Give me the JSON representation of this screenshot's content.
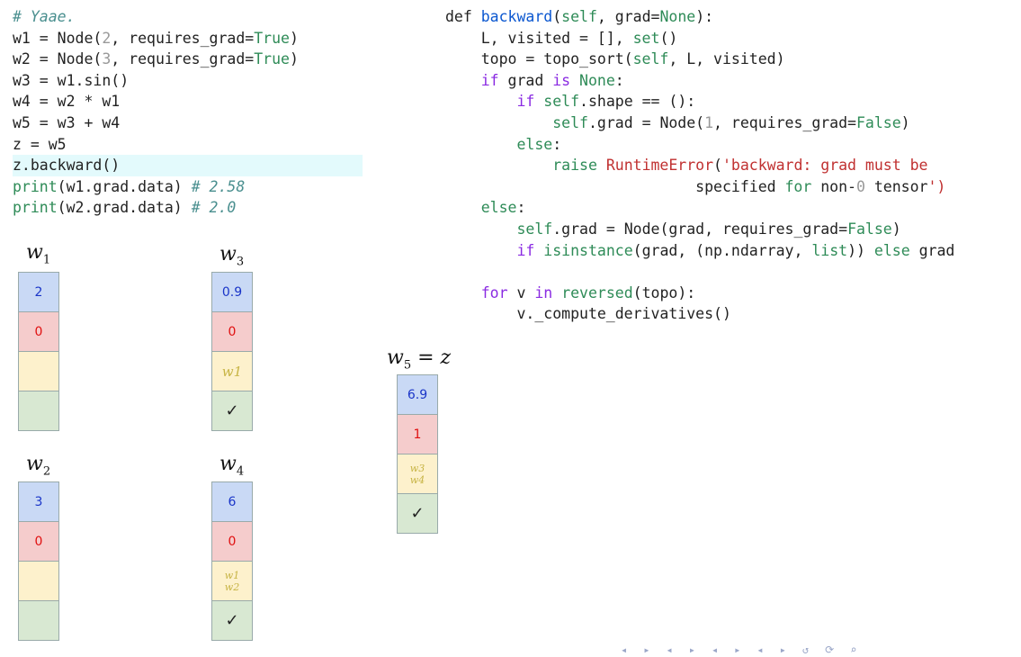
{
  "left_code": [
    {
      "parts": [
        [
          "cm",
          "# Yaae."
        ]
      ]
    },
    {
      "parts": [
        [
          "t",
          "w1 = Node("
        ],
        [
          "num",
          "2"
        ],
        [
          "t",
          ", requires_grad="
        ],
        [
          "tr",
          "True"
        ],
        [
          "t",
          ")"
        ]
      ]
    },
    {
      "parts": [
        [
          "t",
          "w2 = Node("
        ],
        [
          "num",
          "3"
        ],
        [
          "t",
          ", requires_grad="
        ],
        [
          "tr",
          "True"
        ],
        [
          "t",
          ")"
        ]
      ]
    },
    {
      "parts": [
        [
          "t",
          "w3 = w1.sin()"
        ]
      ]
    },
    {
      "parts": [
        [
          "t",
          "w4 = w2 * w1"
        ]
      ]
    },
    {
      "parts": [
        [
          "t",
          "w5 = w3 + w4"
        ]
      ]
    },
    {
      "parts": [
        [
          "t",
          "z = w5"
        ]
      ]
    },
    {
      "parts": [
        [
          "t",
          "z.backward()"
        ]
      ],
      "highlight": true
    },
    {
      "parts": [
        [
          "blt",
          "print"
        ],
        [
          "t",
          "(w1.grad.data) "
        ],
        [
          "cm",
          "# 2.58"
        ]
      ]
    },
    {
      "parts": [
        [
          "blt",
          "print"
        ],
        [
          "t",
          "(w2.grad.data) "
        ],
        [
          "cm",
          "# 2.0"
        ]
      ]
    }
  ],
  "right_code": [
    {
      "parts": [
        [
          "t",
          "def "
        ],
        [
          "fn",
          "backward"
        ],
        [
          "t",
          "("
        ],
        [
          "self",
          "self"
        ],
        [
          "t",
          ", grad="
        ],
        [
          "tr",
          "None"
        ],
        [
          "t",
          "):"
        ]
      ]
    },
    {
      "parts": [
        [
          "t",
          "    L, visited = [], "
        ],
        [
          "blt",
          "set"
        ],
        [
          "t",
          "()"
        ]
      ]
    },
    {
      "parts": [
        [
          "t",
          "    topo = topo_sort("
        ],
        [
          "self",
          "self"
        ],
        [
          "t",
          ", L, visited)"
        ]
      ]
    },
    {
      "parts": [
        [
          "t",
          "    "
        ],
        [
          "kw",
          "if"
        ],
        [
          "t",
          " grad "
        ],
        [
          "kw",
          "is"
        ],
        [
          "t",
          " "
        ],
        [
          "tr",
          "None"
        ],
        [
          "t",
          ":"
        ]
      ]
    },
    {
      "parts": [
        [
          "t",
          "        "
        ],
        [
          "kw",
          "if"
        ],
        [
          "t",
          " "
        ],
        [
          "self",
          "self"
        ],
        [
          "t",
          ".shape == ():"
        ]
      ]
    },
    {
      "parts": [
        [
          "t",
          "            "
        ],
        [
          "self",
          "self"
        ],
        [
          "t",
          ".grad = Node("
        ],
        [
          "num",
          "1"
        ],
        [
          "t",
          ", requires_grad="
        ],
        [
          "tr",
          "False"
        ],
        [
          "t",
          ")"
        ]
      ]
    },
    {
      "parts": [
        [
          "t",
          "        "
        ],
        [
          "tr",
          "else"
        ],
        [
          "t",
          ":"
        ]
      ]
    },
    {
      "parts": [
        [
          "t",
          "            "
        ],
        [
          "tr",
          "raise"
        ],
        [
          "t",
          " "
        ],
        [
          "str",
          "RuntimeError"
        ],
        [
          "t",
          "("
        ],
        [
          "str",
          "'backward: grad must be"
        ]
      ]
    },
    {
      "parts": [
        [
          "str",
          "                            "
        ],
        [
          "t",
          "specified "
        ],
        [
          "tr",
          "for"
        ],
        [
          "t",
          " non-"
        ],
        [
          "num",
          "0"
        ],
        [
          "t",
          " tensor"
        ],
        [
          "str",
          "')"
        ]
      ]
    },
    {
      "parts": [
        [
          "t",
          "    "
        ],
        [
          "tr",
          "else"
        ],
        [
          "t",
          ":"
        ]
      ]
    },
    {
      "parts": [
        [
          "t",
          "        "
        ],
        [
          "self",
          "self"
        ],
        [
          "t",
          ".grad = Node(grad, requires_grad="
        ],
        [
          "tr",
          "False"
        ],
        [
          "t",
          ")"
        ]
      ]
    },
    {
      "parts": [
        [
          "t",
          "        "
        ],
        [
          "kw",
          "if"
        ],
        [
          "t",
          " "
        ],
        [
          "blt",
          "isinstance"
        ],
        [
          "t",
          "(grad, (np.ndarray, "
        ],
        [
          "blt",
          "list"
        ],
        [
          "t",
          ")) "
        ],
        [
          "tr",
          "else"
        ],
        [
          "t",
          " grad"
        ]
      ]
    },
    {
      "parts": [
        [
          "t",
          ""
        ]
      ]
    },
    {
      "parts": [
        [
          "t",
          "    "
        ],
        [
          "kw",
          "for"
        ],
        [
          "t",
          " v "
        ],
        [
          "kw",
          "in"
        ],
        [
          "t",
          " "
        ],
        [
          "blt",
          "reversed"
        ],
        [
          "t",
          "(topo):"
        ]
      ]
    },
    {
      "parts": [
        [
          "t",
          "        v._compute_derivatives()"
        ]
      ]
    }
  ],
  "nodes": {
    "w1": {
      "label_var": "w",
      "label_sub": "1",
      "data": "2",
      "grad": "0",
      "deps": [],
      "done": ""
    },
    "w2": {
      "label_var": "w",
      "label_sub": "2",
      "data": "3",
      "grad": "0",
      "deps": [],
      "done": ""
    },
    "w3": {
      "label_var": "w",
      "label_sub": "3",
      "data": "0.9",
      "grad": "0",
      "deps": [
        "w1"
      ],
      "done": "✓"
    },
    "w4": {
      "label_var": "w",
      "label_sub": "4",
      "data": "6",
      "grad": "0",
      "deps": [
        "w1",
        "w2"
      ],
      "done": "✓"
    },
    "w5": {
      "label_var": "w",
      "label_sub": "5",
      "label_suffix": " = z",
      "data": "6.9",
      "grad": "1",
      "deps": [
        "w3",
        "w4"
      ],
      "done": "✓"
    }
  },
  "navbar": {
    "icons": [
      "◂",
      "▸",
      "◂",
      "▸",
      "◂",
      "▸",
      "◂",
      "▸",
      "↺",
      "⟳",
      "⌕"
    ]
  }
}
